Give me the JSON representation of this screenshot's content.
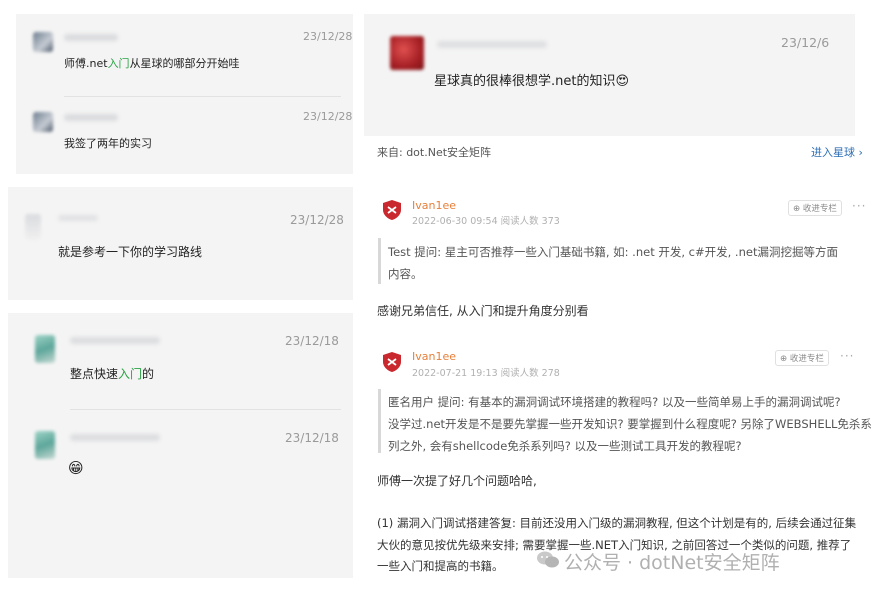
{
  "left_card1": {
    "c1_date": "23/12/28",
    "c1_msg_pre": "师傅.net",
    "c1_msg_green": "入门",
    "c1_msg_post": "从星球的哪部分开始哇",
    "c2_date": "23/12/28",
    "c2_msg": "我签了两年的实习"
  },
  "left_card2": {
    "date": "23/12/28",
    "msg": "就是参考一下你的学习路线"
  },
  "left_card3": {
    "c1_date": "23/12/18",
    "c1_msg_pre": "整点快速",
    "c1_msg_green": "入门",
    "c1_msg_post": "的",
    "c2_date": "23/12/18",
    "c2_emoji": "😁"
  },
  "right_top": {
    "date": "23/12/6",
    "msg": "星球真的很棒很想学.net的知识😍",
    "source": "来自: dot.Net安全矩阵",
    "enter_link": "进入星球 ›"
  },
  "post1": {
    "user": "Ivan1ee",
    "meta": "2022-06-30 09:54   阅读人数 373",
    "collect": "⊕ 收进专栏",
    "more": "···",
    "q1": "Test  提问:   星主可否推荐一些入门基础书籍,  如:  .net 开发,  c#开发,  .net漏洞挖掘等方面",
    "q2": "内容。",
    "answer": "感谢兄弟信任, 从入门和提升角度分别看"
  },
  "post2": {
    "user": "Ivan1ee",
    "meta": "2022-07-21 19:13   阅读人数 278",
    "collect": "⊕ 收进专栏",
    "more": "···",
    "q1": "匿名用户  提问:   有基本的漏洞调试环境搭建的教程吗? 以及一些简单易上手的漏洞调试呢?",
    "q2": "没学过.net开发是不是要先掌握一些开发知识? 要掌握到什么程度呢? 另除了WEBSHELL免杀系",
    "q3": "列之外, 会有shellcode免杀系列吗? 以及一些测试工具开发的教程呢?",
    "a1": "师傅一次提了好几个问题哈哈,",
    "a2": "(1) 漏洞入门调试搭建答复: 目前还没用入门级的漏洞教程, 但这个计划是有的, 后续会通过征集",
    "a3": "大伙的意见按优先级来安排; 需要掌握一些.NET入门知识, 之前回答过一个类似的问题, 推荐了",
    "a4": "一些入门和提高的书籍。"
  },
  "watermark": {
    "text": "公众号 · dotNet安全矩阵"
  },
  "colors": {
    "accent_green": "#2aa344",
    "username_orange": "#e6803a",
    "link_blue": "#2f6fb5",
    "logo_red": "#c8282e"
  }
}
